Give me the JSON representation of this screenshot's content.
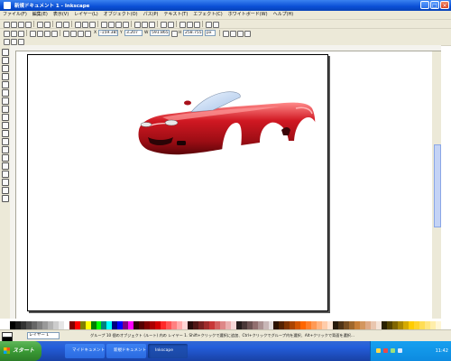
{
  "window": {
    "title": "新規ドキュメント 1 - Inkscape",
    "minimize": "_",
    "maximize": "□",
    "close": "×"
  },
  "menu": [
    "ファイル(F)",
    "編集(E)",
    "表示(V)",
    "レイヤー(L)",
    "オブジェクト(O)",
    "パス(P)",
    "テキスト(T)",
    "エフェクト(C)",
    "ホワイトボード(W)",
    "ヘルプ(H)"
  ],
  "tool_controls": {
    "x_value": "-159.385",
    "y_value": "3.207",
    "w_value": "591.865",
    "h_value": "258.755",
    "unit": "px"
  },
  "palette": [
    "#000000",
    "#1a1a1a",
    "#333333",
    "#4d4d4d",
    "#666666",
    "#808080",
    "#999999",
    "#b3b3b3",
    "#cccccc",
    "#e6e6e6",
    "#ffffff",
    "#800000",
    "#ff0000",
    "#808000",
    "#ffff00",
    "#008000",
    "#00ff00",
    "#008080",
    "#00ffff",
    "#000080",
    "#0000ff",
    "#800080",
    "#ff00ff",
    "#2b0000",
    "#550000",
    "#800000",
    "#aa0000",
    "#d40000",
    "#ff2a2a",
    "#ff5555",
    "#ff8080",
    "#ffaaaa",
    "#ffd5d5",
    "#280b0b",
    "#501616",
    "#782121",
    "#a02c2c",
    "#c83737",
    "#d35f5f",
    "#de8787",
    "#e9afaf",
    "#f4d7d7",
    "#241c1c",
    "#483737",
    "#6c5353",
    "#916f6f",
    "#ac9393",
    "#c8b7b7",
    "#e3dbdb",
    "#2b1100",
    "#552200",
    "#803300",
    "#aa4400",
    "#d45500",
    "#ff6600",
    "#ff7f2a",
    "#ff9955",
    "#ffb380",
    "#ffccaa",
    "#ffe6d5",
    "#281a0b",
    "#503416",
    "#784e21",
    "#a0682c",
    "#c87f37",
    "#d3965f",
    "#deaa87",
    "#e9c6af",
    "#f4e3d7",
    "#2b2200",
    "#554400",
    "#806600",
    "#aa8800",
    "#d4aa00",
    "#ffcc00",
    "#ffd42a",
    "#ffdd55",
    "#ffe680",
    "#ffeeaa",
    "#fff6d5"
  ],
  "status": {
    "layer": "レイヤー 1",
    "message": "グループ 10 個のオブジェクト (ルート) 内の レイヤー 1. Shift+クリックで選択に追加、Ctrl+クリックでグループ内を選択、Alt+クリックで背面を選択..."
  },
  "taskbar": {
    "start_label": "スタート",
    "tasks": [
      "マイドキュメント",
      "新規ドキュメント...",
      "Inkscape"
    ],
    "clock": "11:42"
  },
  "colors": {
    "car_body": "#b3121b",
    "car_highlight": "#ff6b6b",
    "windshield": "#cfe0f5"
  }
}
